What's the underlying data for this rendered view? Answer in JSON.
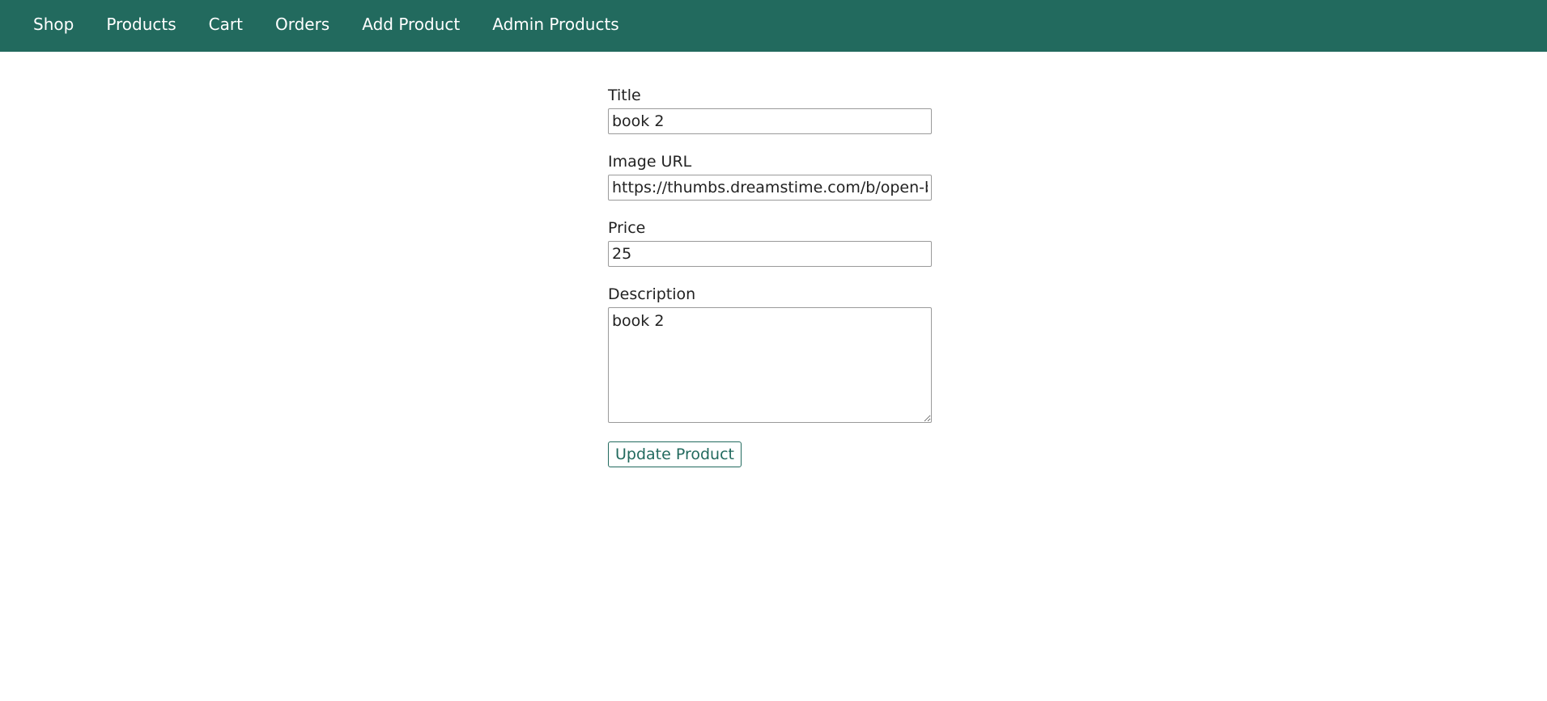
{
  "colors": {
    "header_background": "#226a5e",
    "header_text": "#ffffff",
    "button_accent": "#226a5e"
  },
  "nav": {
    "items": [
      {
        "label": "Shop"
      },
      {
        "label": "Products"
      },
      {
        "label": "Cart"
      },
      {
        "label": "Orders"
      },
      {
        "label": "Add Product"
      },
      {
        "label": "Admin Products"
      }
    ]
  },
  "form": {
    "title": {
      "label": "Title",
      "value": "book 2"
    },
    "image_url": {
      "label": "Image URL",
      "value": "https://thumbs.dreamstime.com/b/open-book"
    },
    "price": {
      "label": "Price",
      "value": "25"
    },
    "description": {
      "label": "Description",
      "value": "book 2"
    },
    "submit_label": "Update Product"
  }
}
